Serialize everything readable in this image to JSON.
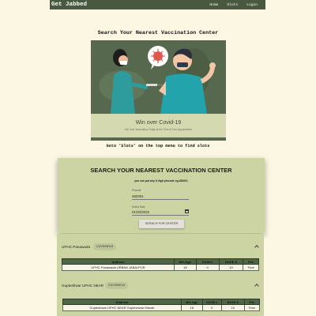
{
  "navbar": {
    "brand": "Get Jabbed",
    "links": [
      "Home",
      "Slots",
      "Login"
    ]
  },
  "hero": {
    "title": "Search Your Nearest Vaccination Center",
    "caption_title": "Win over Covid-19",
    "caption_sub": "Get Your Vaccination Today at the Time of Your Appointment"
  },
  "goto_text": "Goto 'Slots' on the top menu to find slots",
  "search": {
    "title": "SEARCH YOUR NEAREST VACCINATION CENTER",
    "hint": "you can put any 6 digit pincode eg.482001",
    "pincode_label": "Pincode",
    "pincode_value": "482001",
    "date_label": "Select Date",
    "date_value": "01/20/2023",
    "button_label": "SERACH FOR CENTER"
  },
  "results": [
    {
      "name": "UPHC Panawada",
      "badge": "COVISHIELD",
      "headers": [
        "Address",
        "Min Age",
        "DOSE-I",
        "DOSE-II",
        "Fee"
      ],
      "rows": [
        [
          "UPHC Panawada URBAN JABALPUR",
          "18",
          "0",
          "10",
          "Free"
        ]
      ]
    },
    {
      "name": "Gupteshwar UPHC NEAR",
      "badge": "COVISHIELD",
      "headers": [
        "Address",
        "Min Age",
        "DOSE-I",
        "DOSE-II",
        "Fee"
      ],
      "rows": [
        [
          "Gupteshwar UPHC NEAR Gupteshwar Mandir",
          "18",
          "0",
          "10",
          "Free"
        ]
      ]
    }
  ],
  "colors": {
    "page_bg": "#fcf7e3",
    "navbar": "#48593f",
    "card": "#ccd4a4",
    "table_header": "#4e6646"
  },
  "icons": [
    "calendar-icon",
    "chevron-up-icon",
    "virus-icon"
  ]
}
